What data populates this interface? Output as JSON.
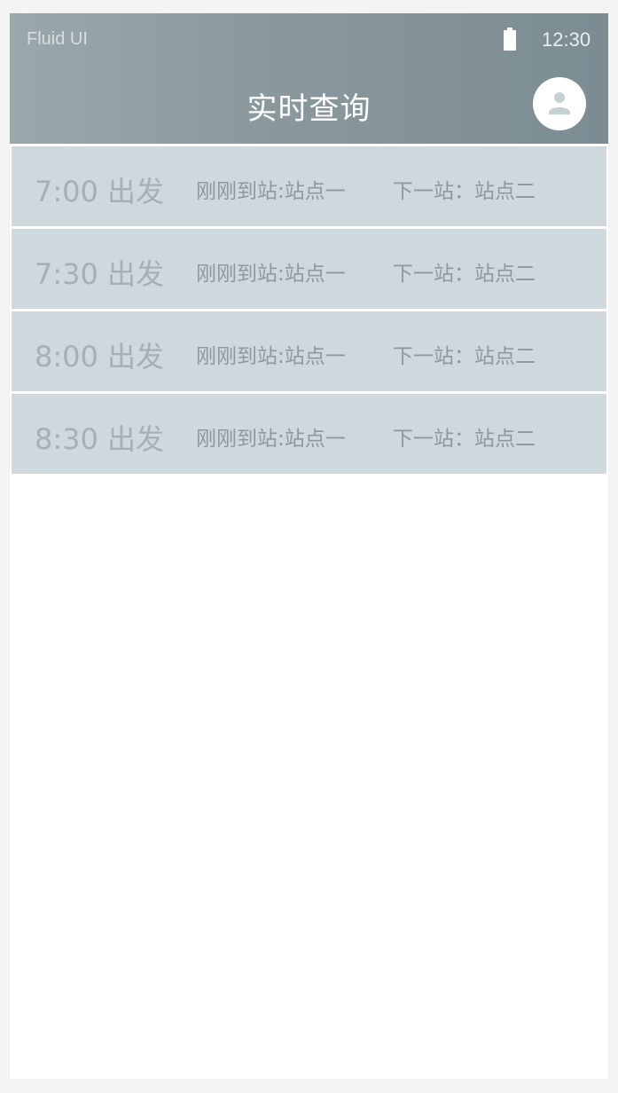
{
  "status_bar": {
    "carrier": "Fluid UI",
    "time": "12:30"
  },
  "header": {
    "title": "实时查询"
  },
  "icons": {
    "battery": "battery-icon",
    "avatar": "user-avatar-icon"
  },
  "colors": {
    "header_start": "#9aa7ab",
    "header_end": "#7b8c93",
    "row_background": "#cfd8dd",
    "row_text": "#8d999f"
  },
  "schedule": [
    {
      "depart": "7:00 出发",
      "arrived": "刚刚到站:站点一",
      "next": "下一站：站点二"
    },
    {
      "depart": "7:30 出发",
      "arrived": "刚刚到站:站点一",
      "next": "下一站：站点二"
    },
    {
      "depart": "8:00 出发",
      "arrived": "刚刚到站:站点一",
      "next": "下一站：站点二"
    },
    {
      "depart": "8:30 出发",
      "arrived": "刚刚到站:站点一",
      "next": "下一站：站点二"
    }
  ]
}
